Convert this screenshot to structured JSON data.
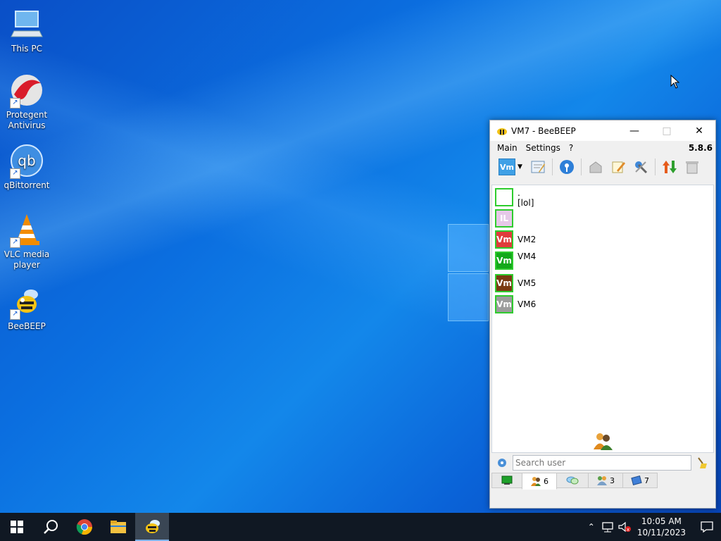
{
  "desktop": {
    "icons": [
      {
        "label": "This PC"
      },
      {
        "label": "Protegent Antivirus"
      },
      {
        "label": "qBittorrent"
      },
      {
        "label": "VLC media player"
      },
      {
        "label": "BeeBEEP"
      }
    ]
  },
  "window": {
    "title": "VM7 - BeeBEEP",
    "menu": [
      "Main",
      "Settings",
      "?"
    ],
    "version": "5.8.6",
    "profile_badge": "Vm",
    "users": [
      {
        "avatar": "",
        "name": ".",
        "status": "[lol]",
        "color": "#ffffff"
      },
      {
        "avatar": "IL",
        "name": "",
        "status": "",
        "color": "#e6c8e8"
      },
      {
        "avatar": "Vm",
        "name": "VM2",
        "status": "",
        "color": "#e03b3b"
      },
      {
        "avatar": "Vm",
        "name": "VM4",
        "status": "",
        "color": "#12a81a"
      },
      {
        "avatar": "Vm",
        "name": "VM5",
        "status": "",
        "color": "#7a3b12"
      },
      {
        "avatar": "Vm",
        "name": "VM6",
        "status": "",
        "color": "#9c9c9c"
      }
    ],
    "search_placeholder": "Search user",
    "tabs": [
      {
        "icon": "computer-icon",
        "count": ""
      },
      {
        "icon": "users-icon",
        "count": "6"
      },
      {
        "icon": "chat-icon",
        "count": ""
      },
      {
        "icon": "groups-icon",
        "count": "3"
      },
      {
        "icon": "files-icon",
        "count": "7"
      }
    ]
  },
  "taskbar": {
    "time": "10:05 AM",
    "date": "10/11/2023"
  },
  "colors": {
    "online_border": "#2ecc2e",
    "taskbar_bg": "#101823"
  }
}
